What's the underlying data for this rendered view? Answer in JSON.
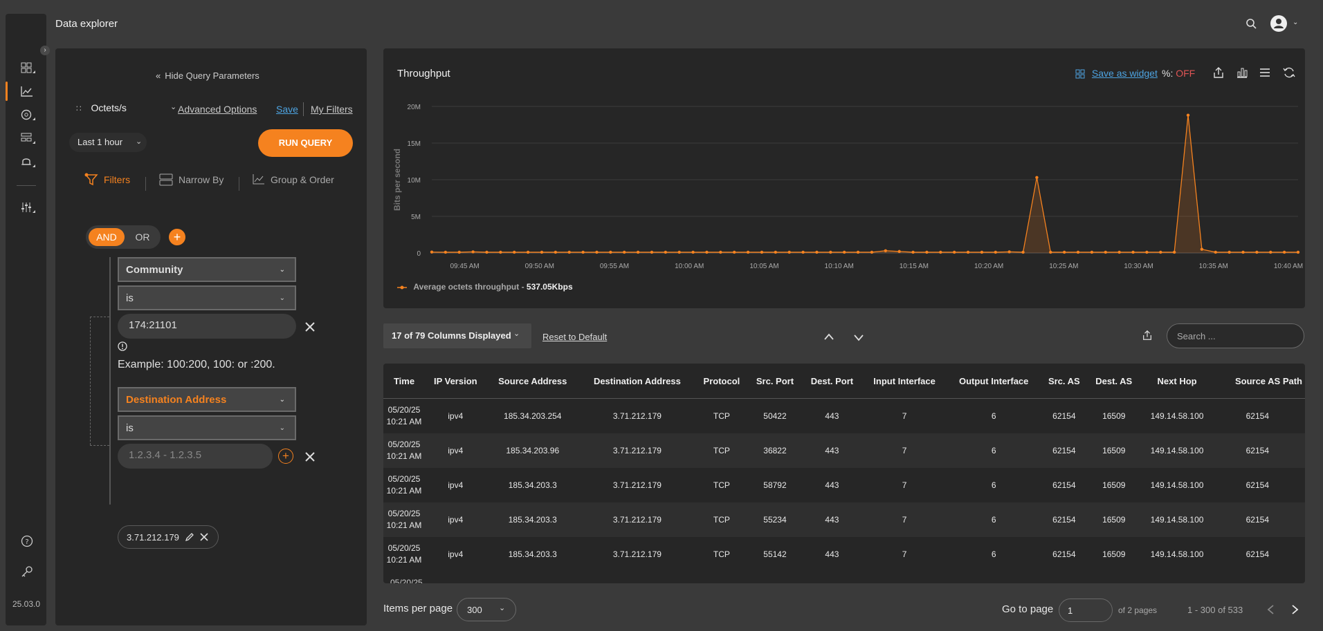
{
  "app": {
    "title": "Data explorer",
    "version": "25.03.0"
  },
  "query": {
    "hide_label": "Hide Query Parameters",
    "metric": "Octets/s",
    "advanced_options": "Advanced Options",
    "save": "Save",
    "my_filters": "My Filters",
    "time_range": "Last 1 hour",
    "run_query": "RUN QUERY",
    "tabs": {
      "filters": "Filters",
      "narrow_by": "Narrow By",
      "group_order": "Group & Order"
    },
    "logic": {
      "and": "AND",
      "or": "OR"
    },
    "filter1": {
      "field": "Community",
      "op": "is",
      "value": "174:21101",
      "hint": "Example: 100:200, 100: or :200."
    },
    "filter2": {
      "field": "Destination Address",
      "op": "is",
      "placeholder": "1.2.3.4 - 1.2.3.5",
      "chip": "3.71.212.179"
    }
  },
  "chart": {
    "title": "Throughput",
    "save_widget": "Save as widget",
    "percent_label": "%:",
    "percent_value": "OFF",
    "legend_label": "Average octets throughput -",
    "legend_value": "537.05Kbps"
  },
  "chart_data": {
    "type": "area",
    "ylabel": "Bits per second",
    "xlabel": "",
    "yticks": [
      "0",
      "5M",
      "10M",
      "15M",
      "20M"
    ],
    "ylim": [
      0,
      20000000
    ],
    "xticks": [
      "09:45 AM",
      "09:50 AM",
      "09:55 AM",
      "10:00 AM",
      "10:05 AM",
      "10:10 AM",
      "10:15 AM",
      "10:20 AM",
      "10:25 AM",
      "10:30 AM",
      "10:35 AM",
      "10:40 AM"
    ],
    "series": [
      {
        "name": "Average octets throughput",
        "color": "#f5821f",
        "values": [
          120000,
          100000,
          100000,
          150000,
          100000,
          100000,
          100000,
          100000,
          100000,
          100000,
          100000,
          100000,
          100000,
          100000,
          100000,
          100000,
          100000,
          100000,
          100000,
          100000,
          100000,
          100000,
          100000,
          100000,
          100000,
          100000,
          100000,
          100000,
          100000,
          100000,
          100000,
          100000,
          100000,
          300000,
          200000,
          100000,
          100000,
          100000,
          100000,
          100000,
          100000,
          100000,
          150000,
          100000,
          10300000,
          100000,
          100000,
          100000,
          100000,
          100000,
          100000,
          100000,
          100000,
          100000,
          100000,
          18800000,
          500000,
          100000,
          100000,
          100000,
          100000,
          100000,
          100000,
          100000
        ]
      }
    ],
    "grid": true,
    "legend": "bottom-left"
  },
  "toolbar": {
    "columns": "17 of 79 Columns Displayed",
    "reset": "Reset to Default",
    "search_placeholder": "Search ..."
  },
  "table": {
    "headers": [
      "Time",
      "IP Version",
      "Source Address",
      "Destination Address",
      "Protocol",
      "Src. Port",
      "Dest. Port",
      "Input Interface",
      "Output Interface",
      "Src. AS",
      "Dest. AS",
      "Next Hop",
      "Source AS Path"
    ],
    "rows": [
      [
        "05/20/25 10:21 AM",
        "ipv4",
        "185.34.203.254",
        "3.71.212.179",
        "TCP",
        "50422",
        "443",
        "7",
        "6",
        "62154",
        "16509",
        "149.14.58.100",
        "62154"
      ],
      [
        "05/20/25 10:21 AM",
        "ipv4",
        "185.34.203.96",
        "3.71.212.179",
        "TCP",
        "36822",
        "443",
        "7",
        "6",
        "62154",
        "16509",
        "149.14.58.100",
        "62154"
      ],
      [
        "05/20/25 10:21 AM",
        "ipv4",
        "185.34.203.3",
        "3.71.212.179",
        "TCP",
        "58792",
        "443",
        "7",
        "6",
        "62154",
        "16509",
        "149.14.58.100",
        "62154"
      ],
      [
        "05/20/25 10:21 AM",
        "ipv4",
        "185.34.203.3",
        "3.71.212.179",
        "TCP",
        "55234",
        "443",
        "7",
        "6",
        "62154",
        "16509",
        "149.14.58.100",
        "62154"
      ],
      [
        "05/20/25 10:21 AM",
        "ipv4",
        "185.34.203.3",
        "3.71.212.179",
        "TCP",
        "55142",
        "443",
        "7",
        "6",
        "62154",
        "16509",
        "149.14.58.100",
        "62154"
      ]
    ]
  },
  "pagination": {
    "items_per_page_label": "Items per page",
    "items_per_page": "300",
    "go_to_page_label": "Go to page",
    "page": "1",
    "of_pages": "of 2 pages",
    "range": "1 - 300 of 533"
  }
}
